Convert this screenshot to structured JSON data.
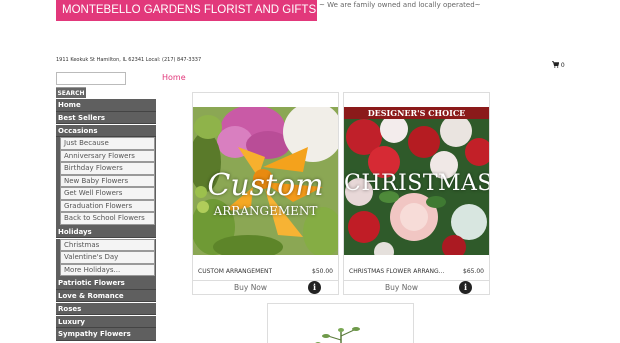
{
  "header": {
    "shop_name": "MONTEBELLO GARDENS FLORIST AND GIFTS",
    "tagline": "~ We are family owned and locally operated~",
    "brand_color": "#e2387b",
    "address": "1911 Keokuk St Hamilton, IL 62341  Local: (217) 847-3337"
  },
  "cart": {
    "icon": "shopping-cart-icon",
    "count": "0"
  },
  "search": {
    "button_label": "SEARCH",
    "placeholder": ""
  },
  "breadcrumb": {
    "home": "Home"
  },
  "sidebar": {
    "home": "Home",
    "best_sellers": "Best Sellers",
    "occasions": {
      "label": "Occasions",
      "items": [
        "Just Because",
        "Anniversary Flowers",
        "Birthday Flowers",
        "New Baby Flowers",
        "Get Well Flowers",
        "Graduation Flowers",
        "Back to School Flowers"
      ]
    },
    "holidays": {
      "label": "Holidays",
      "items": [
        "Christmas",
        "Valentine's Day",
        "More Holidays..."
      ]
    },
    "more": [
      "Patriotic Flowers",
      "Love & Romance",
      "Roses",
      "Luxury",
      "Sympathy Flowers"
    ]
  },
  "products": [
    {
      "name": "CUSTOM ARRANGEMENT",
      "price": "$50.00",
      "buy_label": "Buy Now",
      "image_text_main": "Custom",
      "image_text_sub": "ARRANGEMENT"
    },
    {
      "name": "CHRISTMAS FLOWER ARRANG...",
      "price": "$65.00",
      "buy_label": "Buy Now",
      "image_banner": "DESIGNER'S CHOICE",
      "image_text_main": "CHRISTMAS"
    }
  ]
}
